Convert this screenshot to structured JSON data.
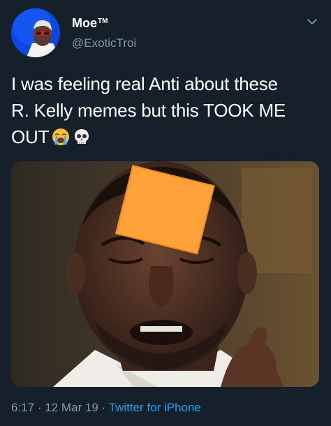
{
  "tweet": {
    "display_name": "Moe",
    "verified_mark": "TM",
    "handle": "@ExoticTroi",
    "text_lines": [
      "I was feeling real Anti about these",
      "R. Kelly memes but this TOOK ME",
      "OUT"
    ],
    "emojis": [
      "loudly-crying-face-icon",
      "skull-icon"
    ],
    "time": "6:17",
    "separator": "·",
    "date": "12 Mar 19",
    "source": "Twitter for iPhone"
  },
  "colors": {
    "background": "#15202b",
    "text_primary": "#ffffff",
    "text_secondary": "#8899a6",
    "link": "#1da1f2",
    "cheese": "#ffa23a"
  }
}
